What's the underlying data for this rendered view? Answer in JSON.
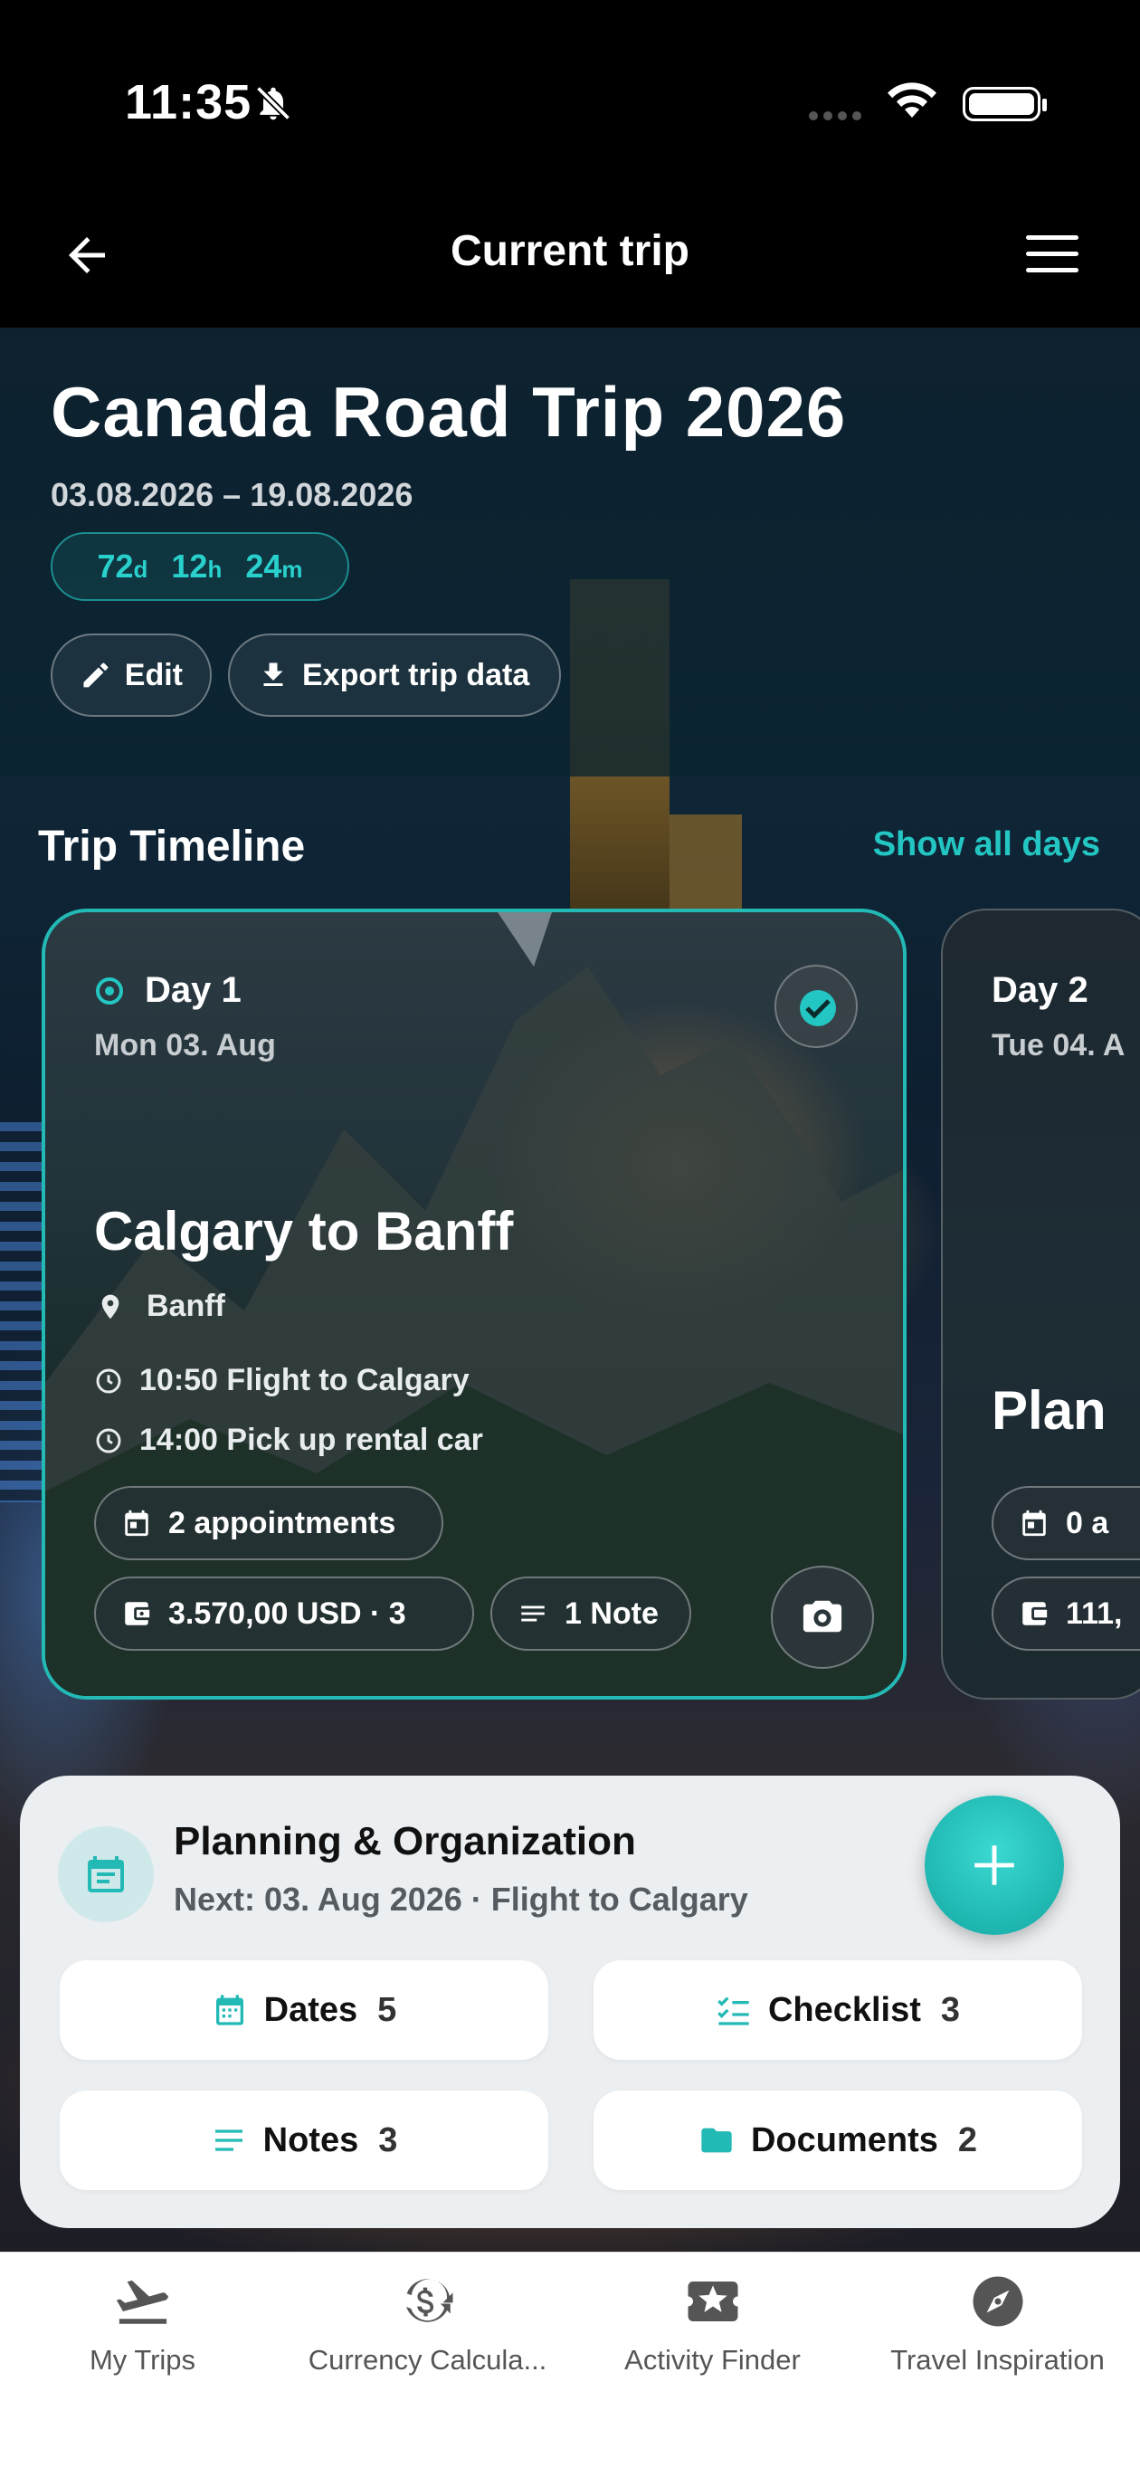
{
  "status_bar": {
    "time": "11:35"
  },
  "nav": {
    "title": "Current trip"
  },
  "trip": {
    "title": "Canada Road Trip 2026",
    "dates": "03.08.2026 – 19.08.2026",
    "countdown": {
      "days": "72",
      "days_unit": "d",
      "hours": "12",
      "hours_unit": "h",
      "minutes": "24",
      "minutes_unit": "m"
    },
    "edit_label": "Edit",
    "export_label": "Export trip data"
  },
  "timeline": {
    "title": "Trip Timeline",
    "show_all_label": "Show all days",
    "days": [
      {
        "label": "Day 1",
        "date": "Mon 03. Aug",
        "title": "Calgary to Banff",
        "location": "Banff",
        "events": [
          "10:50 Flight to Calgary",
          "14:00 Pick up rental car"
        ],
        "appointments": "2 appointments",
        "budget": "3.570,00 USD · 3",
        "notes": "1 Note",
        "completed": true
      },
      {
        "label": "Day 2",
        "date": "Tue 04. A",
        "title": "Plan",
        "appointments": "0 a",
        "budget": "111,"
      }
    ]
  },
  "planning": {
    "title": "Planning & Organization",
    "next": "Next: 03. Aug 2026 · Flight to Calgary",
    "tiles": [
      {
        "label": "Dates",
        "count": "5",
        "icon": "calendar-icon"
      },
      {
        "label": "Checklist",
        "count": "3",
        "icon": "checklist-icon"
      },
      {
        "label": "Notes",
        "count": "3",
        "icon": "notes-icon"
      },
      {
        "label": "Documents",
        "count": "2",
        "icon": "folder-icon"
      }
    ]
  },
  "tabs": [
    {
      "label": "My Trips",
      "icon": "plane-icon"
    },
    {
      "label": "Currency Calcula...",
      "icon": "currency-exchange-icon"
    },
    {
      "label": "Activity Finder",
      "icon": "ticket-star-icon"
    },
    {
      "label": "Travel Inspiration",
      "icon": "compass-icon"
    }
  ],
  "colors": {
    "accent": "#23c6c2",
    "background": "#05080c",
    "panel": "#eceff1"
  }
}
